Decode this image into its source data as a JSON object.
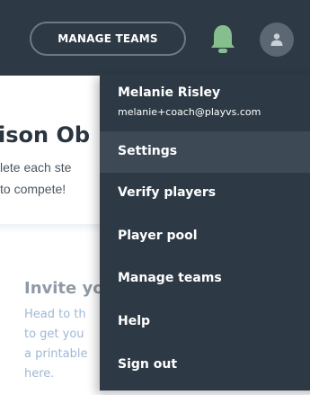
{
  "topbar": {
    "manage_teams_label": "MANAGE TEAMS",
    "notifications_icon": "bell-icon",
    "avatar_icon": "user-icon"
  },
  "background": {
    "section_title": "ison Ob",
    "section_lines": [
      "lete each ste",
      "to compete!"
    ],
    "card": {
      "title": "Invite yo",
      "lines": [
        "Head to th",
        "to get you",
        "a printable",
        "here."
      ]
    }
  },
  "user_menu": {
    "name": "Melanie Risley",
    "email": "melanie+coach@playvs.com",
    "items": [
      {
        "label": "Settings"
      },
      {
        "label": "Verify players"
      },
      {
        "label": "Player pool"
      },
      {
        "label": "Manage teams"
      },
      {
        "label": "Help"
      },
      {
        "label": "Sign out"
      }
    ]
  },
  "colors": {
    "nav_bg": "#2d3a45",
    "highlight_bg": "#3d4a56",
    "link_text": "#9fb8d4"
  }
}
